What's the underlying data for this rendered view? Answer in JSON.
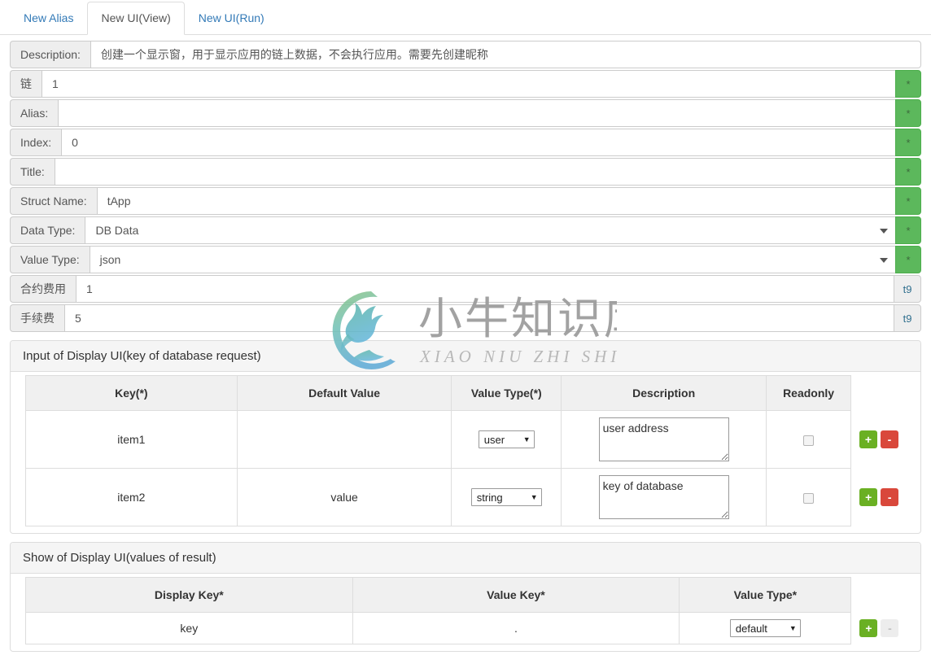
{
  "tabs": [
    {
      "label": "New Alias",
      "active": false
    },
    {
      "label": "New UI(View)",
      "active": true
    },
    {
      "label": "New UI(Run)",
      "active": false
    }
  ],
  "form": {
    "rows": [
      {
        "label": "Description:",
        "value": "创建一个显示窗，用于显示应用的链上数据，不会执行应用。需要先创建昵称",
        "suffix": "",
        "type": "text"
      },
      {
        "label": "链",
        "value": "1",
        "suffix": "*",
        "type": "text"
      },
      {
        "label": "Alias:",
        "value": "",
        "suffix": "*",
        "type": "text"
      },
      {
        "label": "Index:",
        "value": "0",
        "suffix": "*",
        "type": "text"
      },
      {
        "label": "Title:",
        "value": "",
        "suffix": "*",
        "type": "text"
      },
      {
        "label": "Struct Name:",
        "value": "tApp",
        "suffix": "*",
        "type": "text"
      },
      {
        "label": "Data Type:",
        "value": "DB Data",
        "suffix": "*",
        "type": "select"
      },
      {
        "label": "Value Type:",
        "value": "json",
        "suffix": "*",
        "type": "select"
      },
      {
        "label": "合约费用",
        "value": "1",
        "suffix": "t9",
        "type": "text"
      },
      {
        "label": "手续费",
        "value": "5",
        "suffix": "t9",
        "type": "text"
      }
    ]
  },
  "input_panel": {
    "title": "Input of Display UI(key of database request)",
    "columns": [
      "Key(*)",
      "Default Value",
      "Value Type(*)",
      "Description",
      "Readonly",
      ""
    ],
    "rows": [
      {
        "key": "item1",
        "default_value": "",
        "value_type": "user",
        "description": "user address",
        "readonly": false,
        "add_label": "+",
        "del_label": "-"
      },
      {
        "key": "item2",
        "default_value": "value",
        "value_type": "string",
        "description": "key of database",
        "readonly": false,
        "add_label": "+",
        "del_label": "-"
      }
    ]
  },
  "show_panel": {
    "title": "Show of Display UI(values of result)",
    "columns": [
      "Display Key*",
      "Value Key*",
      "Value Type*",
      ""
    ],
    "rows": [
      {
        "display_key": "key",
        "value_key": ".",
        "value_type": "default",
        "add_label": "+",
        "del_label": "-"
      }
    ]
  },
  "watermark": {
    "cn": "小牛知识库",
    "py": "XIAO NIU ZHI SHI KU"
  },
  "colors": {
    "link": "#337ab7",
    "green_suffix": "#5cb85c",
    "add_button": "#6ab023",
    "delete_button": "#d9483b",
    "panel_header": "#f5f5f5"
  }
}
